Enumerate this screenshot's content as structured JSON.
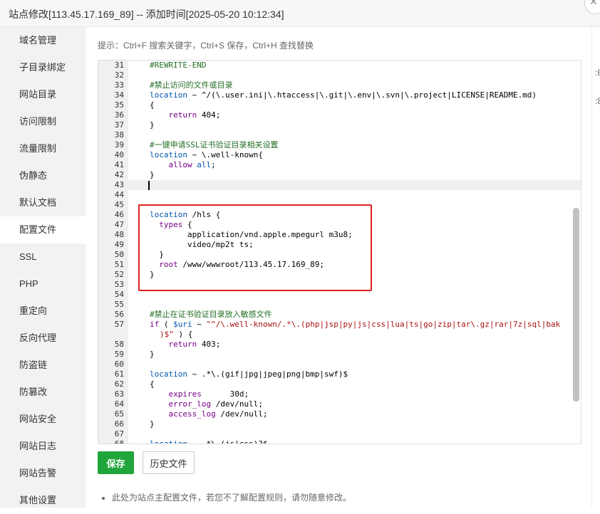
{
  "window": {
    "title": "站点修改[113.45.17.169_89] -- 添加时间[2025-05-20 10:12:34]"
  },
  "sidebar": {
    "items": [
      {
        "label": "域名管理",
        "active": false
      },
      {
        "label": "子目录绑定",
        "active": false
      },
      {
        "label": "网站目录",
        "active": false
      },
      {
        "label": "访问限制",
        "active": false
      },
      {
        "label": "流量限制",
        "active": false
      },
      {
        "label": "伪静态",
        "active": false
      },
      {
        "label": "默认文档",
        "active": false
      },
      {
        "label": "配置文件",
        "active": true
      },
      {
        "label": "SSL",
        "active": false
      },
      {
        "label": "PHP",
        "active": false
      },
      {
        "label": "重定向",
        "active": false
      },
      {
        "label": "反向代理",
        "active": false
      },
      {
        "label": "防盗链",
        "active": false
      },
      {
        "label": "防篡改",
        "active": false
      },
      {
        "label": "网站安全",
        "active": false
      },
      {
        "label": "网站日志",
        "active": false
      },
      {
        "label": "网站告警",
        "active": false
      },
      {
        "label": "其他设置",
        "active": false
      }
    ]
  },
  "tip": "提示：Ctrl+F 搜索关键字，Ctrl+S 保存，Ctrl+H 查找替换",
  "editor": {
    "cursor_line": 43,
    "lines": [
      {
        "n": "31",
        "html": "    <span class='c-comment'>#REWRITE-END</span>"
      },
      {
        "n": "32",
        "html": ""
      },
      {
        "n": "33",
        "html": "    <span class='c-comment'>#禁止访问的文件或目录</span>"
      },
      {
        "n": "34",
        "html": "    <span class='c-var'>location</span> ~ ^/(\\.user.ini|\\.htaccess|\\.git|\\.env|\\.svn|\\.project|LICENSE|README.md)"
      },
      {
        "n": "35",
        "html": "    {"
      },
      {
        "n": "36",
        "html": "        <span class='c-kw'>return</span> 404;"
      },
      {
        "n": "37",
        "html": "    }"
      },
      {
        "n": "38",
        "html": ""
      },
      {
        "n": "39",
        "html": "    <span class='c-comment'>#一键申请SSL证书验证目录相关设置</span>"
      },
      {
        "n": "40",
        "html": "    <span class='c-var'>location</span> ~ \\.well-known{"
      },
      {
        "n": "41",
        "html": "        <span class='c-kw'>allow</span> <span class='c-var'>all</span>;"
      },
      {
        "n": "42",
        "html": "    }"
      },
      {
        "n": "43",
        "html": ""
      },
      {
        "n": "44",
        "html": ""
      },
      {
        "n": "45",
        "html": ""
      },
      {
        "n": "46",
        "html": "    <span class='c-var'>location</span> /hls {"
      },
      {
        "n": "47",
        "html": "      <span class='c-kw'>types</span> {"
      },
      {
        "n": "48",
        "html": "            application/vnd.apple.mpegurl m3u8;"
      },
      {
        "n": "49",
        "html": "            video/mp2t ts;"
      },
      {
        "n": "50",
        "html": "      }"
      },
      {
        "n": "51",
        "html": "      <span class='c-kw'>root</span> /www/wwwroot/113.45.17.169_89;"
      },
      {
        "n": "52",
        "html": "    }"
      },
      {
        "n": "53",
        "html": ""
      },
      {
        "n": "54",
        "html": ""
      },
      {
        "n": "55",
        "html": ""
      },
      {
        "n": "56",
        "html": "    <span class='c-comment'>#禁止在证书验证目录放入敏感文件</span>"
      },
      {
        "n": "57",
        "html": "    <span class='c-kw'>if</span> ( <span class='c-var'>$uri</span> ~ <span class='c-str'>\"^/\\.well-known/.*\\.(php|jsp|py|js|css|lua|ts|go|zip|tar\\.gz|rar|7z|sql|bak</span>"
      },
      {
        "n": "",
        "html": "    <span class='c-str'>)$\"</span> ) {",
        "cont": true
      },
      {
        "n": "58",
        "html": "        <span class='c-kw'>return</span> 403;"
      },
      {
        "n": "59",
        "html": "    }"
      },
      {
        "n": "60",
        "html": ""
      },
      {
        "n": "61",
        "html": "    <span class='c-var'>location</span> ~ .*\\.(gif|jpg|jpeg|png|bmp|swf)$"
      },
      {
        "n": "62",
        "html": "    {"
      },
      {
        "n": "63",
        "html": "        <span class='c-kw'>expires</span>      30d;"
      },
      {
        "n": "64",
        "html": "        <span class='c-kw'>error_log</span> /dev/null;"
      },
      {
        "n": "65",
        "html": "        <span class='c-kw'>access_log</span> /dev/null;"
      },
      {
        "n": "66",
        "html": "    }"
      },
      {
        "n": "67",
        "html": ""
      },
      {
        "n": "68",
        "html": "    <span class='c-var'>location</span> ~ .*\\.(js|css)?$"
      }
    ]
  },
  "buttons": {
    "save": "保存",
    "history": "历史文件"
  },
  "note": "此处为站点主配置文件，若您不了解配置规则，请勿随意修改。",
  "outer": {
    "fragment": ":8"
  }
}
